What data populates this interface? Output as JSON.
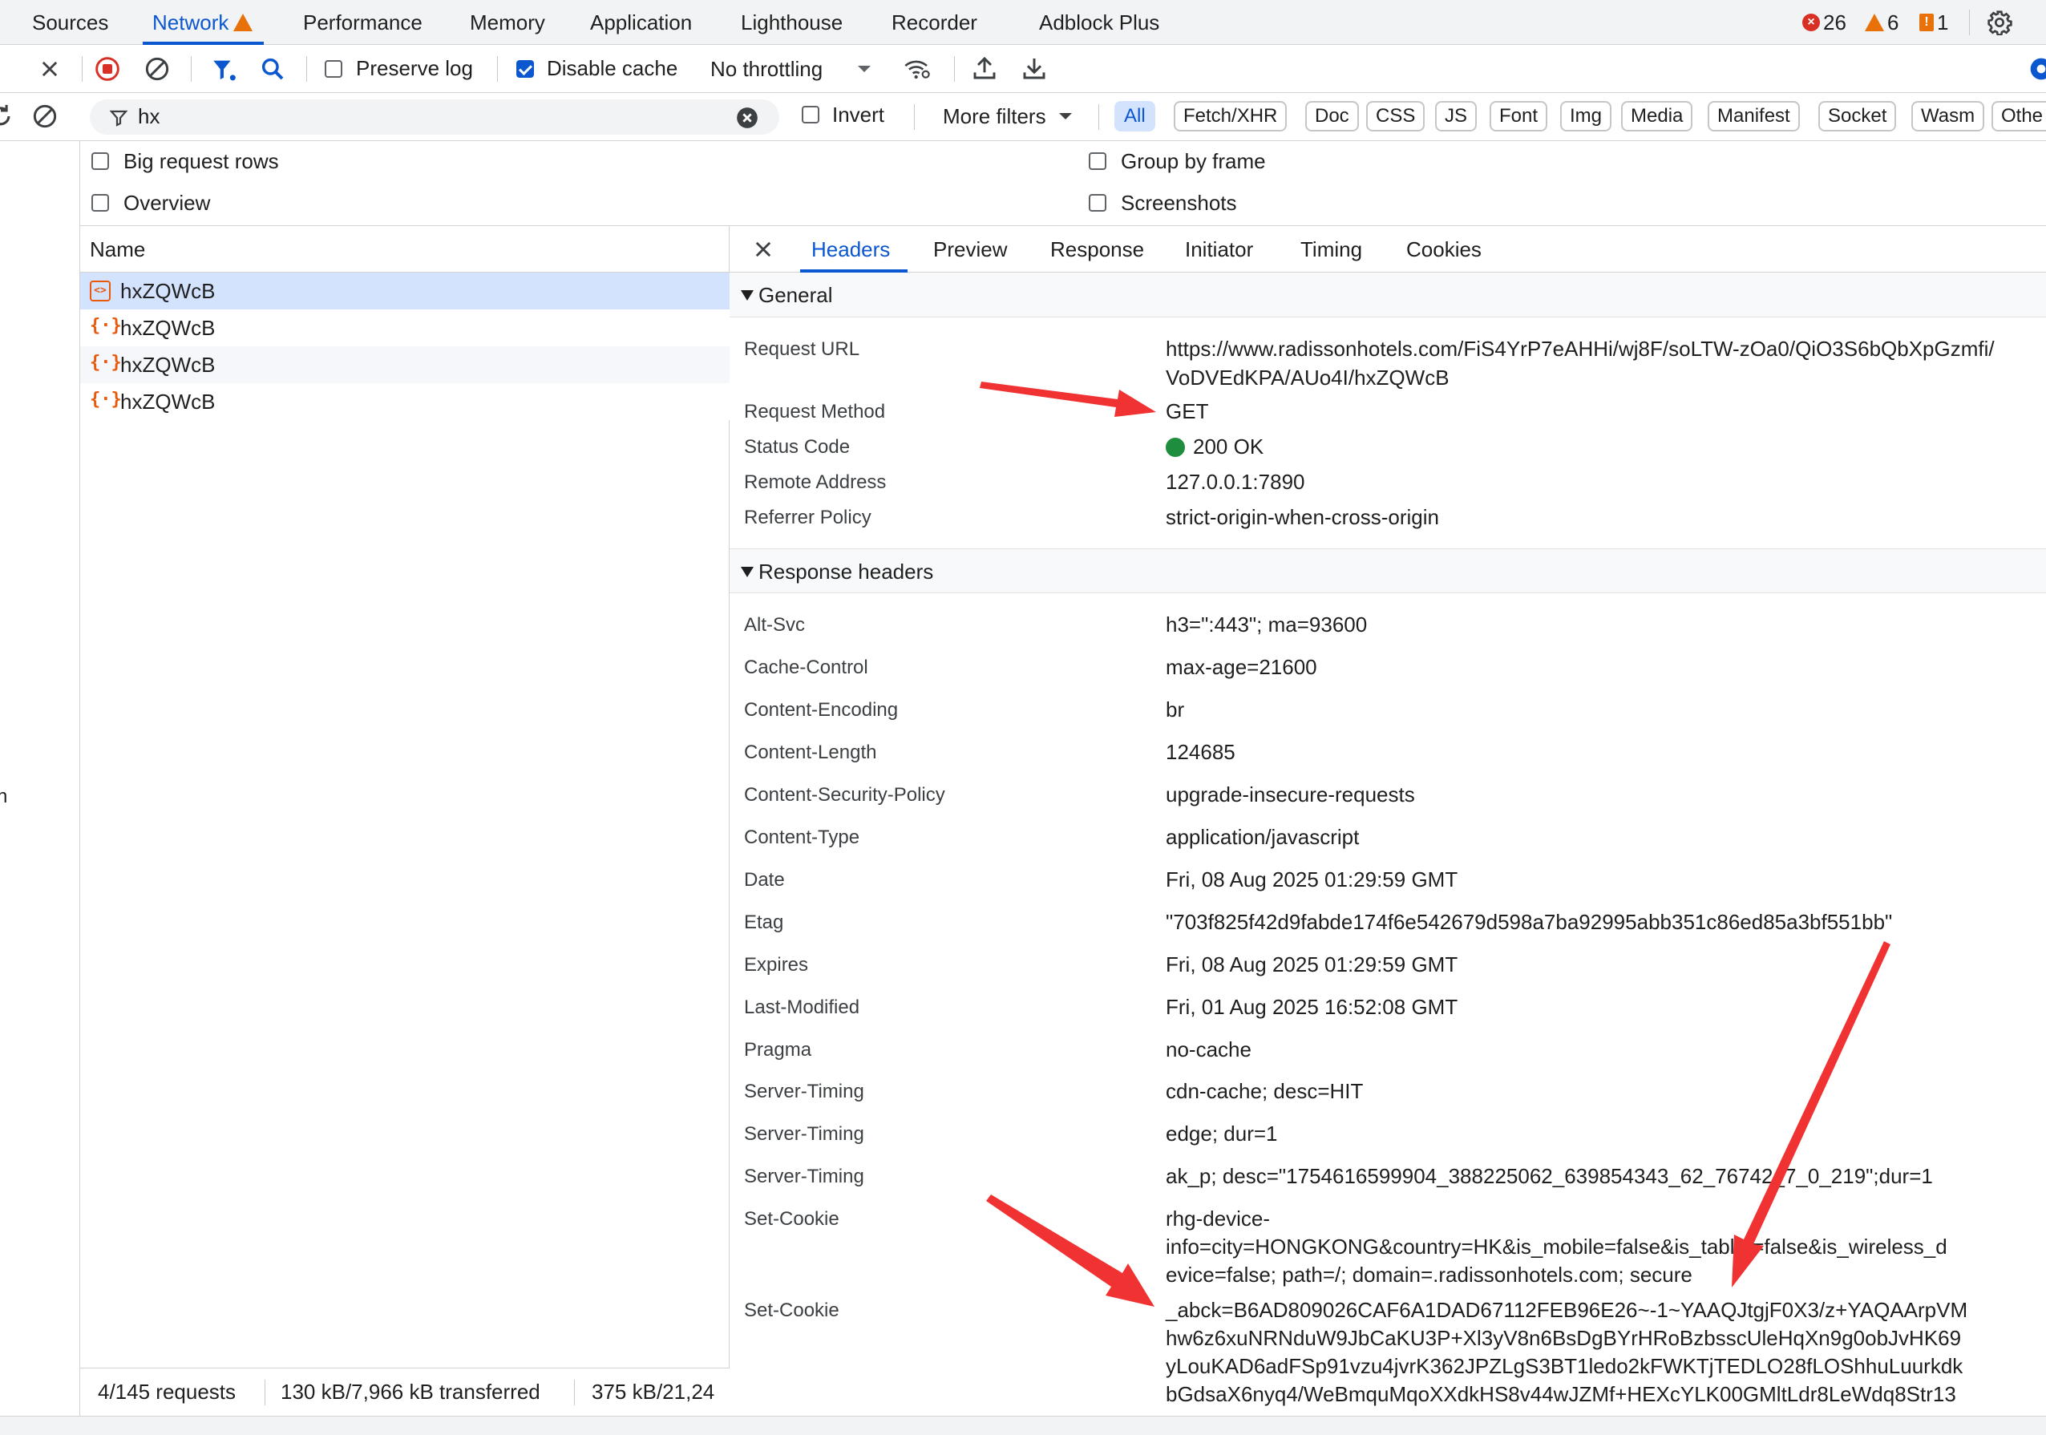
{
  "panel_tabs": [
    {
      "label": "Sources",
      "active": false
    },
    {
      "label": "Network",
      "active": true
    },
    {
      "label": "Performance",
      "active": false
    },
    {
      "label": "Memory",
      "active": false
    },
    {
      "label": "Application",
      "active": false
    },
    {
      "label": "Lighthouse",
      "active": false
    },
    {
      "label": "Recorder",
      "active": false
    },
    {
      "label": "Adblock Plus",
      "active": false
    }
  ],
  "counters": {
    "errors": "26",
    "warnings": "6",
    "issues": "1"
  },
  "toolbar": {
    "preserve_log_label": "Preserve log",
    "preserve_log_checked": false,
    "disable_cache_label": "Disable cache",
    "disable_cache_checked": true,
    "throttling_value": "No throttling"
  },
  "filter": {
    "value": "hx",
    "invert_label": "Invert",
    "more_filters_label": "More filters",
    "types": [
      "All",
      "Fetch/XHR",
      "Doc",
      "CSS",
      "JS",
      "Font",
      "Img",
      "Media",
      "Manifest",
      "Socket",
      "Wasm",
      "Othe"
    ],
    "active_type": "All"
  },
  "settings": {
    "big_rows_label": "Big request rows",
    "overview_label": "Overview",
    "group_by_frame_label": "Group by frame",
    "screenshots_label": "Screenshots"
  },
  "request_list": {
    "column_name": "Name",
    "rows": [
      {
        "name": "hxZQWcB",
        "selected": true
      },
      {
        "name": "hxZQWcB",
        "selected": false
      },
      {
        "name": "hxZQWcB",
        "selected": false
      },
      {
        "name": "hxZQWcB",
        "selected": false
      }
    ]
  },
  "status_bar": {
    "requests": "4/145 requests",
    "transferred": "130 kB/7,966 kB transferred",
    "resources": "375 kB/21,24"
  },
  "gutter_text": "n",
  "detail_tabs": [
    {
      "label": "Headers",
      "active": true
    },
    {
      "label": "Preview",
      "active": false
    },
    {
      "label": "Response",
      "active": false
    },
    {
      "label": "Initiator",
      "active": false
    },
    {
      "label": "Timing",
      "active": false
    },
    {
      "label": "Cookies",
      "active": false
    }
  ],
  "general": {
    "title": "General",
    "rows": [
      {
        "key": "Request URL",
        "lines": [
          "https://www.radissonhotels.com/FiS4YrP7eAHHi/wj8F/soLTW-zOa0/QiO3S6bQbXpGzmfi/",
          "VoDVEdKPA/AUo4I/hxZQWcB"
        ]
      },
      {
        "key": "Request Method",
        "lines": [
          "GET"
        ]
      },
      {
        "key": "Status Code",
        "lines": [
          "200 OK"
        ],
        "status_color": "#1e8e3e"
      },
      {
        "key": "Remote Address",
        "lines": [
          "127.0.0.1:7890"
        ]
      },
      {
        "key": "Referrer Policy",
        "lines": [
          "strict-origin-when-cross-origin"
        ]
      }
    ]
  },
  "response_headers": {
    "title": "Response headers",
    "rows": [
      {
        "key": "Alt-Svc",
        "lines": [
          "h3=\":443\"; ma=93600"
        ]
      },
      {
        "key": "Cache-Control",
        "lines": [
          "max-age=21600"
        ]
      },
      {
        "key": "Content-Encoding",
        "lines": [
          "br"
        ]
      },
      {
        "key": "Content-Length",
        "lines": [
          "124685"
        ]
      },
      {
        "key": "Content-Security-Policy",
        "lines": [
          "upgrade-insecure-requests"
        ]
      },
      {
        "key": "Content-Type",
        "lines": [
          "application/javascript"
        ]
      },
      {
        "key": "Date",
        "lines": [
          "Fri, 08 Aug 2025 01:29:59 GMT"
        ]
      },
      {
        "key": "Etag",
        "lines": [
          "\"703f825f42d9fabde174f6e542679d598a7ba92995abb351c86ed85a3bf551bb\""
        ]
      },
      {
        "key": "Expires",
        "lines": [
          "Fri, 08 Aug 2025 01:29:59 GMT"
        ]
      },
      {
        "key": "Last-Modified",
        "lines": [
          "Fri, 01 Aug 2025 16:52:08 GMT"
        ]
      },
      {
        "key": "Pragma",
        "lines": [
          "no-cache"
        ]
      },
      {
        "key": "Server-Timing",
        "lines": [
          "cdn-cache; desc=HIT"
        ]
      },
      {
        "key": "Server-Timing",
        "lines": [
          "edge; dur=1"
        ]
      },
      {
        "key": "Server-Timing",
        "lines": [
          "ak_p; desc=\"1754616599904_388225062_639854343_62_76742_7_0_219\";dur=1"
        ]
      },
      {
        "key": "Set-Cookie",
        "lines": [
          "rhg-device-",
          "info=city=HONGKONG&country=HK&is_mobile=false&is_tablet=false&is_wireless_d",
          "evice=false; path=/; domain=.radissonhotels.com; secure"
        ]
      },
      {
        "key": "Set-Cookie",
        "lines": [
          "_abck=B6AD809026CAF6A1DAD67112FEB96E26~-1~YAAQJtgjF0X3/z+YAQAArpVM",
          "hw6z6xuNRNduW9JbCaKU3P+Xl3yV8n6BsDgBYrHRoBzbsscUleHqXn9g0obJvHK69",
          "yLouKAD6adFSp91vzu4jvrK362JPZLgS3BT1ledo2kFWKTjTEDLO28fLOShhuLuurkdk",
          "bGdsaX6nyq4/WeBmquMqoXXdkHS8v44wJZMf+HEXcYLK00GMltLdr8LeWdq8Str13"
        ]
      }
    ]
  },
  "colors": {
    "accent": "#0b57d0",
    "annotation_arrow": "#f03232",
    "status_ok": "#1e8e3e",
    "warning": "#e8710a",
    "error": "#d93025"
  }
}
